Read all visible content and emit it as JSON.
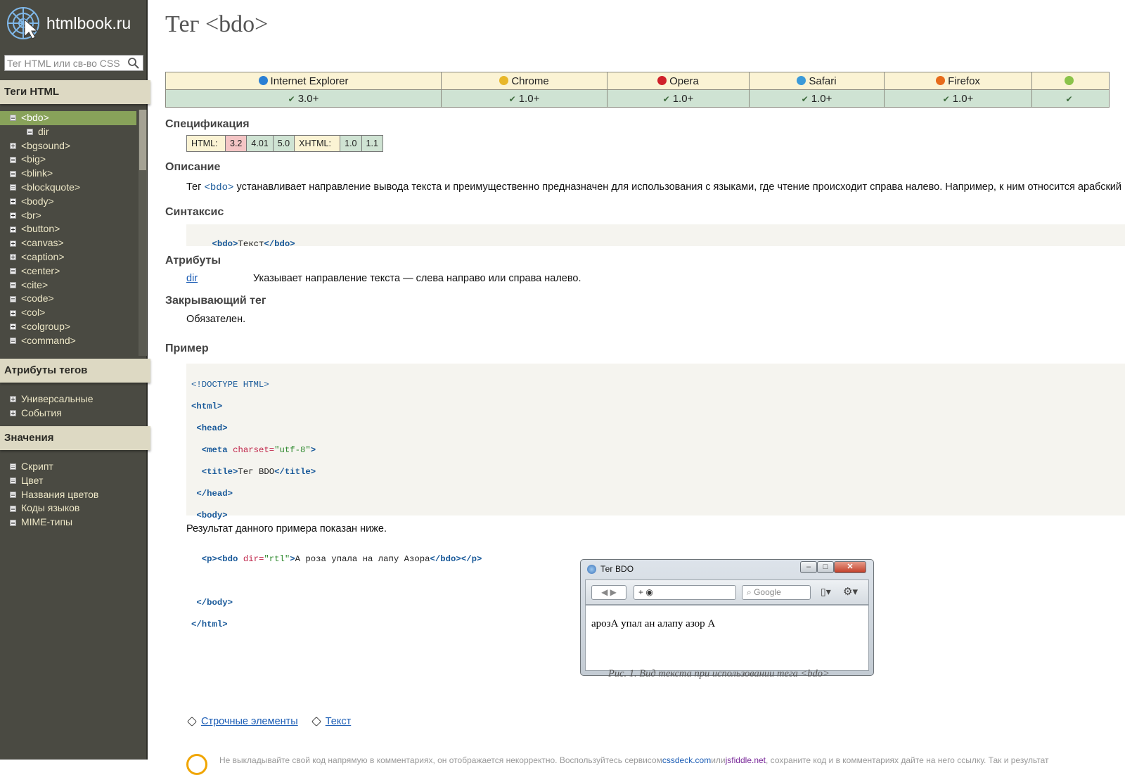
{
  "site": {
    "name": "htmlbook.ru"
  },
  "search": {
    "placeholder": "Тег HTML или св-во CSS"
  },
  "sidebar": {
    "tags_heading": "Теги HTML",
    "tags": [
      {
        "label": "<bdo>",
        "icon": "doc",
        "active": true
      },
      {
        "label": "dir",
        "icon": "doc",
        "sub": true
      },
      {
        "label": "<bgsound>",
        "icon": "plus"
      },
      {
        "label": "<big>",
        "icon": "doc"
      },
      {
        "label": "<blink>",
        "icon": "doc"
      },
      {
        "label": "<blockquote>",
        "icon": "doc"
      },
      {
        "label": "<body>",
        "icon": "plus"
      },
      {
        "label": "<br>",
        "icon": "plus"
      },
      {
        "label": "<button>",
        "icon": "plus"
      },
      {
        "label": "<canvas>",
        "icon": "plus"
      },
      {
        "label": "<caption>",
        "icon": "plus"
      },
      {
        "label": "<center>",
        "icon": "doc"
      },
      {
        "label": "<cite>",
        "icon": "doc"
      },
      {
        "label": "<code>",
        "icon": "doc"
      },
      {
        "label": "<col>",
        "icon": "plus"
      },
      {
        "label": "<colgroup>",
        "icon": "plus"
      },
      {
        "label": "<command>",
        "icon": "doc"
      }
    ],
    "attrs_heading": "Атрибуты тегов",
    "attrs": [
      {
        "label": "Универсальные",
        "icon": "plus"
      },
      {
        "label": "События",
        "icon": "plus"
      }
    ],
    "values_heading": "Значения",
    "values": [
      {
        "label": "Скрипт",
        "icon": "doc"
      },
      {
        "label": "Цвет",
        "icon": "doc"
      },
      {
        "label": "Названия цветов",
        "icon": "doc"
      },
      {
        "label": "Коды языков",
        "icon": "doc"
      },
      {
        "label": "MIME-типы",
        "icon": "doc"
      }
    ]
  },
  "page": {
    "title": "Тег <bdo>"
  },
  "browsers": [
    {
      "name": "Internet Explorer",
      "version": "3.0+",
      "color": "#2a7fd4"
    },
    {
      "name": "Chrome",
      "version": "1.0+",
      "color": "#e8b72a"
    },
    {
      "name": "Opera",
      "version": "1.0+",
      "color": "#d0202a"
    },
    {
      "name": "Safari",
      "version": "1.0+",
      "color": "#3b9ad9"
    },
    {
      "name": "Firefox",
      "version": "1.0+",
      "color": "#e76b1b"
    },
    {
      "name": "",
      "version": "",
      "color": "#8bc34a"
    }
  ],
  "spec": {
    "heading": "Спецификация",
    "html_label": "HTML:",
    "html_versions": [
      "3.2",
      "4.01",
      "5.0"
    ],
    "xhtml_label": "XHTML:",
    "xhtml_versions": [
      "1.0",
      "1.1"
    ]
  },
  "description": {
    "heading": "Описание",
    "prefix": "Тег ",
    "tag": "<bdo>",
    "text": " устанавливает направление вывода текста и преимущественно предназначен для использования с языками, где чтение происходит справа налево. Например, к ним относится арабский"
  },
  "syntax": {
    "heading": "Синтаксис",
    "open": "<bdo>",
    "text": "Текст",
    "close": "</bdo>"
  },
  "attributes": {
    "heading": "Атрибуты",
    "items": [
      {
        "name": "dir",
        "desc": "Указывает направление текста — слева направо или справа налево."
      }
    ]
  },
  "closing": {
    "heading": "Закрывающий тег",
    "text": "Обязателен."
  },
  "example": {
    "heading": "Пример",
    "code": {
      "doctype": "<!DOCTYPE HTML>",
      "html_open": "<html>",
      "head_open": "<head>",
      "meta_open": "<meta",
      "meta_attr": "charset=",
      "meta_val": "\"utf-8\"",
      "meta_close": ">",
      "title_open": "<title>",
      "title_text": "Тег BDO",
      "title_close": "</title>",
      "head_close": "</head>",
      "body_open": "<body>",
      "p_open": "<p>",
      "bdo_open": "<bdo",
      "bdo_attr": "dir=",
      "bdo_val": "\"rtl\"",
      "bdo_gt": ">",
      "bdo_text": "А роза упала на лапу Азора",
      "bdo_close": "</bdo>",
      "p_close": "</p>",
      "body_close": "</body>",
      "html_close": "</html>"
    },
    "result_text": "Результат данного примера показан ниже."
  },
  "mock_window": {
    "title": "Тег BDO",
    "search_placeholder": "Google",
    "content": "арозА упал ан алапу азор А"
  },
  "figure": {
    "caption": "Рис. 1. Вид текста при использовании тега <bdo>"
  },
  "related": {
    "links": [
      "Строчные элементы",
      "Текст"
    ]
  },
  "notice": {
    "text1": "Не выкладывайте свой код напрямую в комментариях, он отображается некорректно. Воспользуйтесь сервисом ",
    "link1": "cssdeck.com",
    "text2": " или ",
    "link2": "jsfiddle.net",
    "text3": ", сохраните код и в комментариях дайте на него ссылку. Так и результат"
  }
}
